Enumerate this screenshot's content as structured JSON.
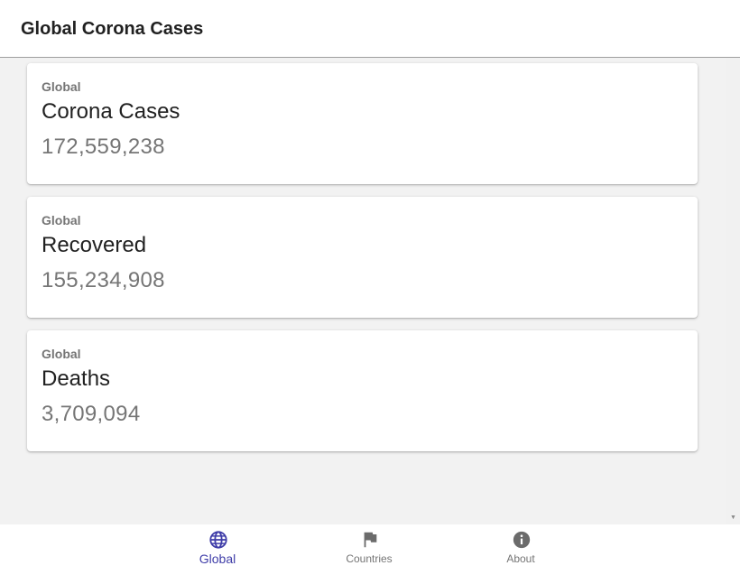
{
  "header": {
    "title": "Global Corona Cases"
  },
  "cards": [
    {
      "overline": "Global",
      "title": "Corona Cases",
      "value": "172,559,238"
    },
    {
      "overline": "Global",
      "title": "Recovered",
      "value": "155,234,908"
    },
    {
      "overline": "Global",
      "title": "Deaths",
      "value": "3,709,094"
    }
  ],
  "bottom_nav": {
    "items": [
      {
        "label": "Global",
        "icon": "globe-icon",
        "active": true
      },
      {
        "label": "Countries",
        "icon": "flag-icon",
        "active": false
      },
      {
        "label": "About",
        "icon": "info-icon",
        "active": false
      }
    ]
  },
  "colors": {
    "accent": "#3f3da8",
    "inactive": "#757575",
    "background": "#f2f2f2",
    "card": "#ffffff"
  }
}
